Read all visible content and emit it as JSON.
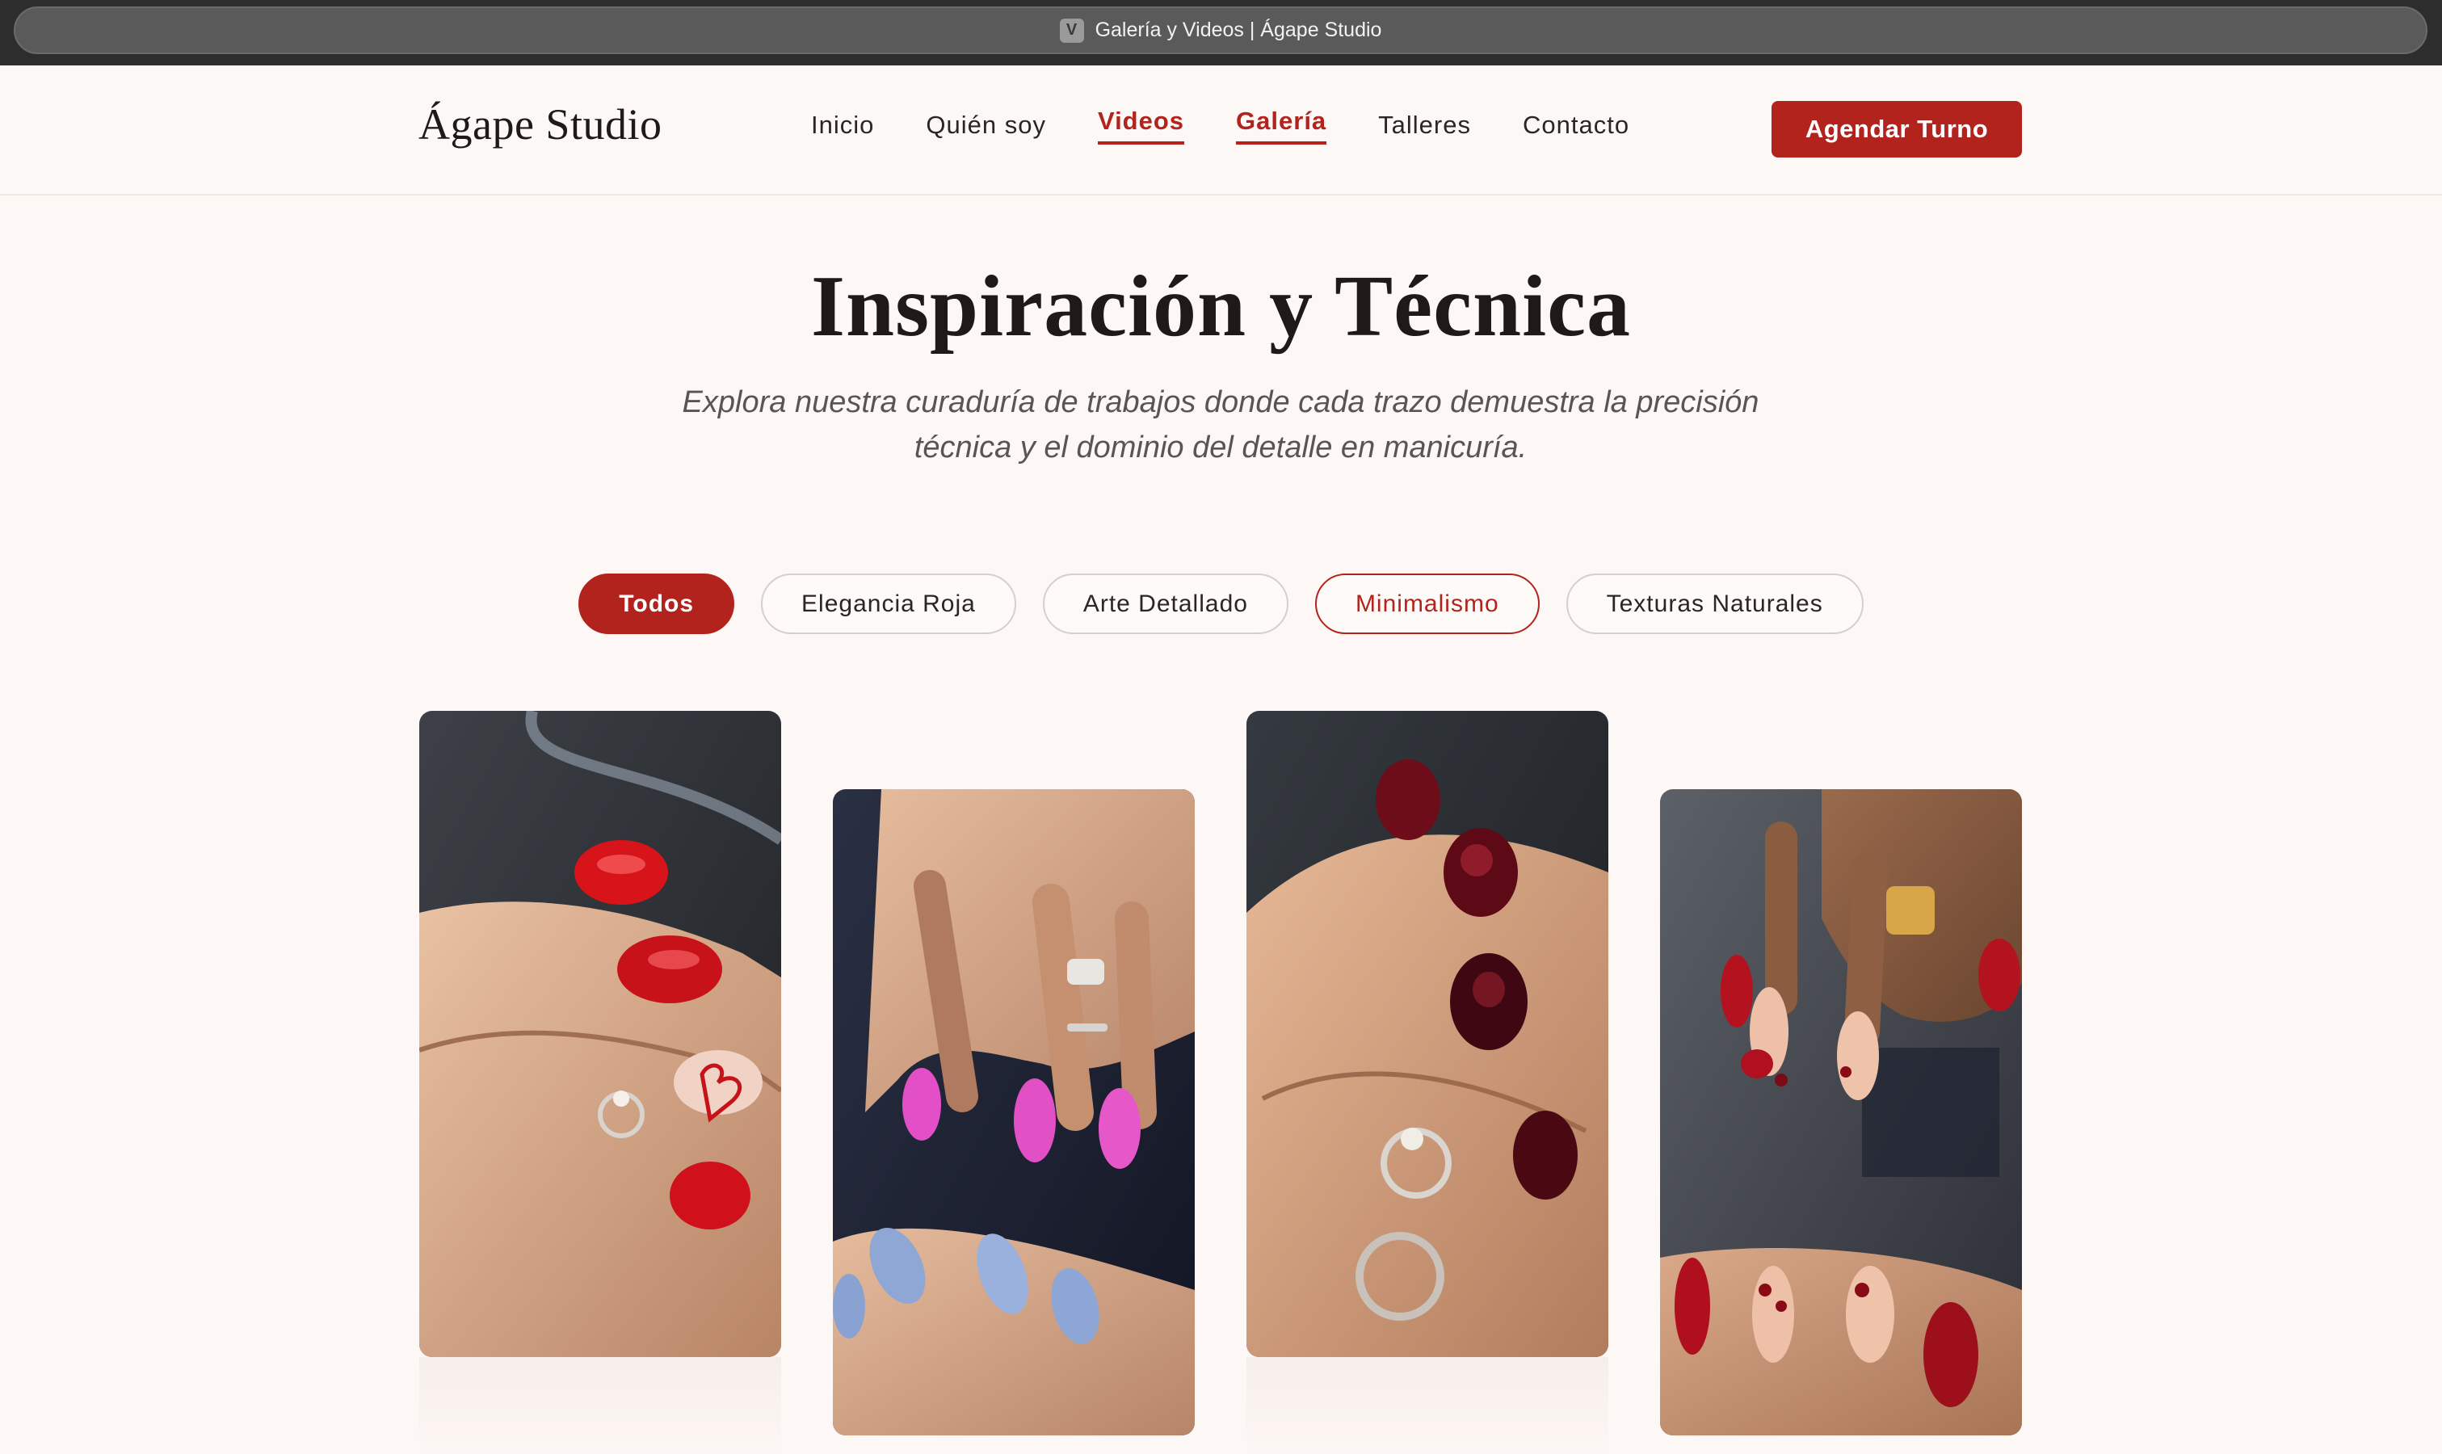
{
  "browser": {
    "tab_icon_letter": "V",
    "title": "Galería y Videos | Ágape Studio"
  },
  "header": {
    "logo": "Ágape Studio",
    "nav": [
      {
        "label": "Inicio"
      },
      {
        "label": "Quién soy"
      },
      {
        "label": "Videos",
        "active": true
      },
      {
        "label": "Galería",
        "active": true
      },
      {
        "label": "Talleres"
      },
      {
        "label": "Contacto"
      }
    ],
    "cta_label": "Agendar Turno"
  },
  "hero": {
    "title": "Inspiración y Técnica",
    "subtitle_line1": "Explora nuestra curaduría de trabajos donde cada trazo demuestra la precisión",
    "subtitle_line2": "técnica y el dominio del detalle en manicuría."
  },
  "filters": [
    {
      "label": "Todos",
      "state": "selected"
    },
    {
      "label": "Elegancia Roja",
      "state": "default"
    },
    {
      "label": "Arte Detallado",
      "state": "default"
    },
    {
      "label": "Minimalismo",
      "state": "outlined"
    },
    {
      "label": "Texturas Naturales",
      "state": "default"
    }
  ],
  "gallery": [
    {
      "description": "red-nails-heart-design"
    },
    {
      "description": "pink-and-blue-chrome-nails"
    },
    {
      "description": "dark-cherry-nails"
    },
    {
      "description": "red-nails-dotted-french"
    }
  ],
  "colors": {
    "accent": "#b3231d",
    "background": "#fdf7f5",
    "text": "#2b2523"
  }
}
